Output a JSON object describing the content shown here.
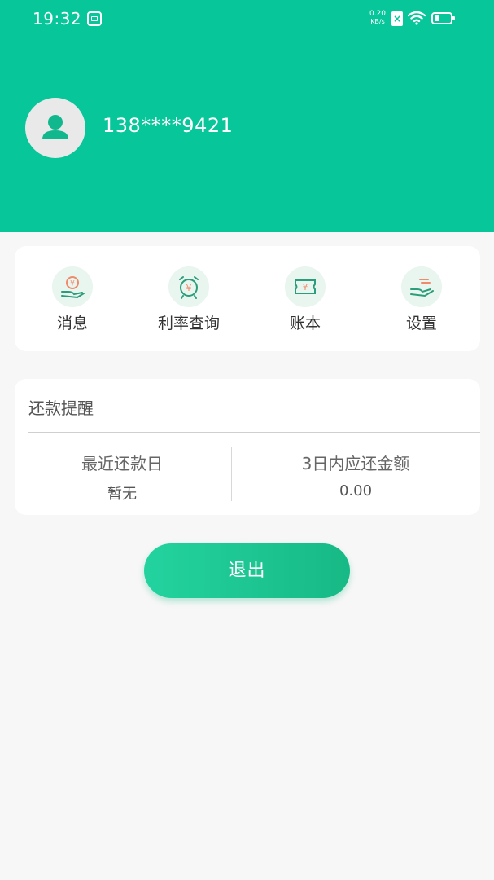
{
  "status_bar": {
    "time": "19:32",
    "net_speed_value": "0.20",
    "net_speed_unit": "KB/s",
    "battery_level": 0.35,
    "icons": [
      "app-notification-icon",
      "sim-disabled-icon",
      "wifi-icon",
      "battery-icon"
    ]
  },
  "profile": {
    "avatar_icon": "person-icon",
    "phone": "138****9421"
  },
  "menu": {
    "items": [
      {
        "label": "消息",
        "icon": "hand-moneybag-icon"
      },
      {
        "label": "利率查询",
        "icon": "alarm-clock-yuan-icon"
      },
      {
        "label": "账本",
        "icon": "ticket-yuan-icon"
      },
      {
        "label": "设置",
        "icon": "hand-lines-icon"
      }
    ]
  },
  "repayment_reminder": {
    "title": "还款提醒",
    "recent_due_label": "最近还款日",
    "recent_due_value": "暂无",
    "three_day_label": "3日内应还金额",
    "three_day_value": "0.00"
  },
  "logout": {
    "label": "退出"
  },
  "colors": {
    "brand": "#06c69a",
    "icon_bg": "#e9f5ef",
    "icon_orange": "#f08a6a",
    "icon_green": "#2a9d7a"
  }
}
